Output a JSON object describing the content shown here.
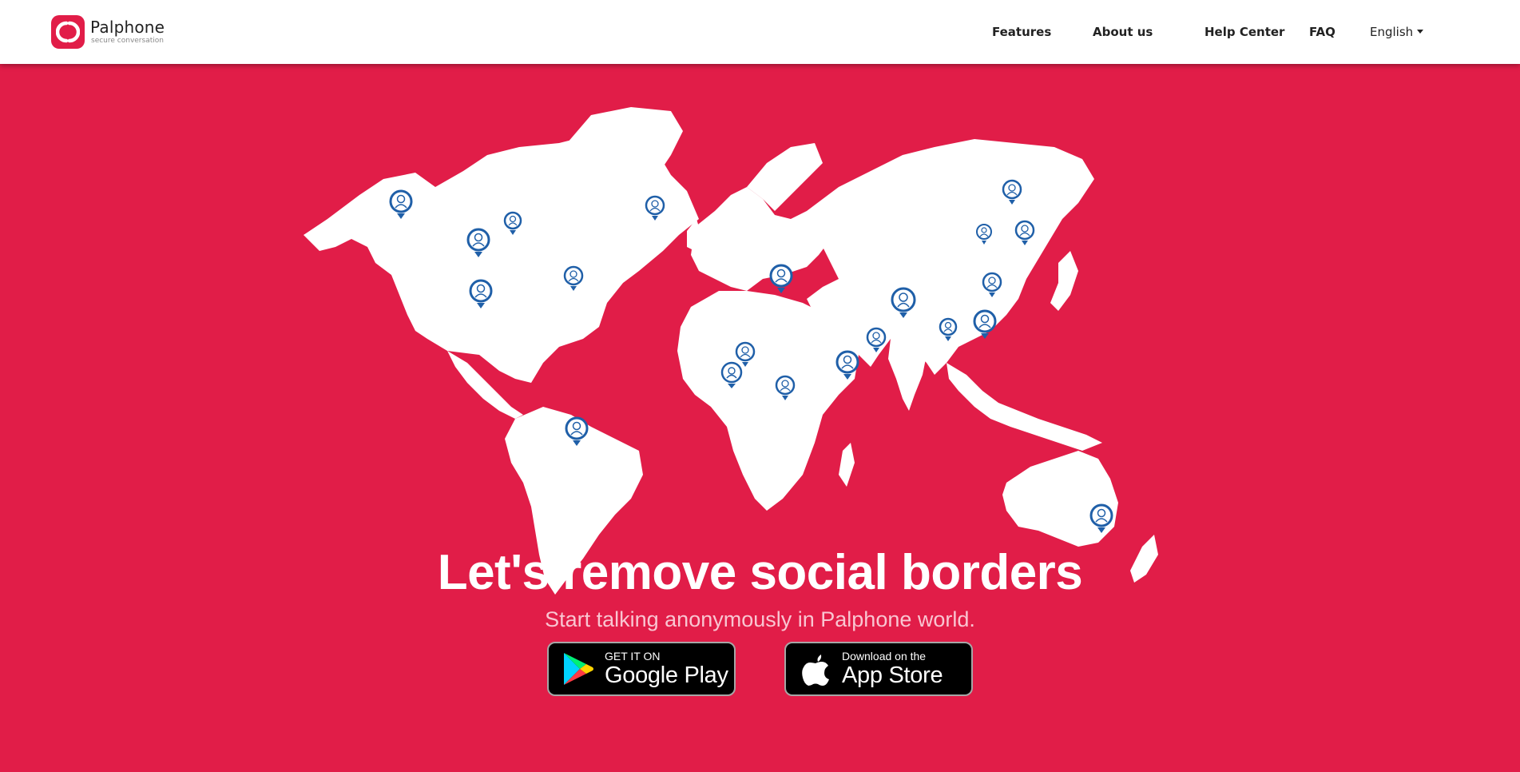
{
  "brand": {
    "name": "Palphone",
    "tagline": "secure conversation",
    "color": "#e11d48"
  },
  "nav": {
    "items": [
      {
        "label": "Features"
      },
      {
        "label": "About us"
      },
      {
        "label": "Help Center"
      },
      {
        "label": "FAQ"
      }
    ],
    "language": {
      "selected": "English",
      "icon": "chevron-down-icon"
    }
  },
  "hero": {
    "background": "#e11d48",
    "map_fill": "#ffffff",
    "pin_color": "#1f5fa8",
    "headline": "Let's remove social borders",
    "subheadline": "Start talking anonymously in Palphone world."
  },
  "stores": {
    "google": {
      "small": "GET IT ON",
      "big": "Google Play",
      "icon": "google-play-icon"
    },
    "apple": {
      "small": "Download on the",
      "big": "App Store",
      "icon": "apple-icon"
    }
  }
}
